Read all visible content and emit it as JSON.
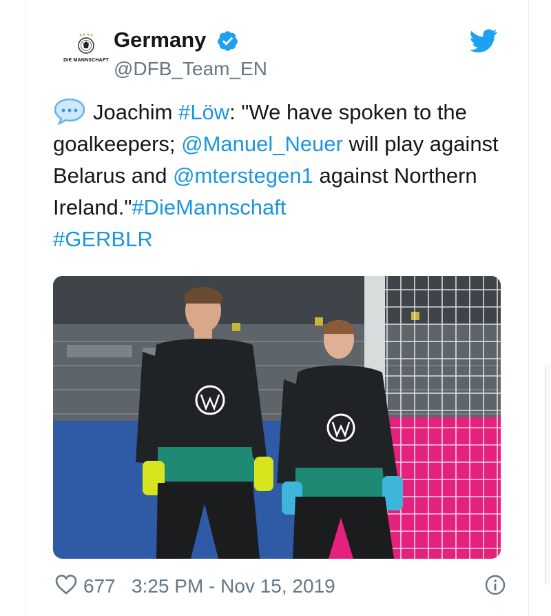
{
  "account": {
    "display_name": "Germany",
    "handle": "@DFB_Team_EN",
    "avatar_text": "DIE MANNSCHAFT",
    "verified": true
  },
  "tweet": {
    "emoji": "speech-bubble-icon",
    "text_1": "Joachim ",
    "hashtag_low": "#Löw",
    "text_2": ": \"We have spoken to the goalkeepers; ",
    "mention_neuer": "@Manuel_Neuer",
    "text_3": " will play against Belarus and ",
    "mention_terstegen": "@mterstegen1",
    "text_4": " against Northern Ireland.\"",
    "hashtag_team": "#DieMannschaft",
    "hashtag_match": "#GERBLR"
  },
  "media": {
    "kind": "photo",
    "subject": "two goalkeepers in black training tops at a stadium",
    "advertising_board_color": "#e4227d"
  },
  "footer": {
    "likes": "677",
    "timestamp": "3:25 PM - Nov 15, 2019"
  },
  "colors": {
    "link": "#1b95e0",
    "secondary": "#657786",
    "verified": "#1da1f2"
  }
}
